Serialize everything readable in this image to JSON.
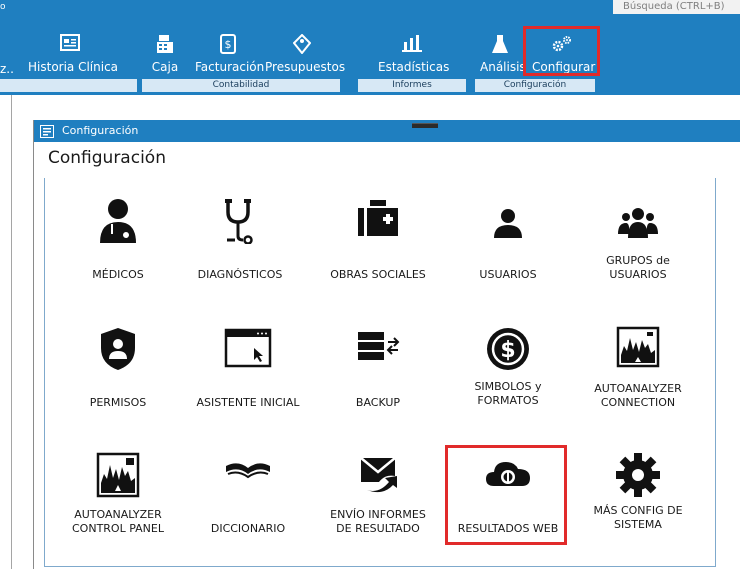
{
  "search": {
    "placeholder": "Búsqueda (CTRL+B)"
  },
  "ribbon": {
    "dot": "o",
    "truncated": "z..",
    "historia": "Historia Clínica",
    "caja": "Caja",
    "facturacion": "Facturación",
    "presupuestos": "Presupuestos",
    "estadisticas": "Estadísticas",
    "analisis": "Análisis",
    "configurar": "Configurar",
    "groups": {
      "contabilidad": "Contabilidad",
      "informes": "Informes",
      "configuracion": "Configuración"
    }
  },
  "window": {
    "title": "Configuración",
    "heading": "Configuración"
  },
  "tiles": {
    "medicos": "MÉDICOS",
    "diagnosticos": "DIAGNÓSTICOS",
    "obras": "OBRAS SOCIALES",
    "usuarios": "USUARIOS",
    "grupos1": "GRUPOS de",
    "grupos2": "USUARIOS",
    "permisos": "PERMISOS",
    "asistente": "ASISTENTE INICIAL",
    "backup": "BACKUP",
    "simbolos1": "SIMBOLOS y",
    "simbolos2": "FORMATOS",
    "autoconn1": "AUTOANALYZER",
    "autoconn2": "CONNECTION",
    "autopanel1": "AUTOANALYZER",
    "autopanel2": "CONTROL PANEL",
    "diccionario": "DICCIONARIO",
    "envio1": "ENVÍO INFORMES",
    "envio2": "DE RESULTADO",
    "resultados": "RESULTADOS WEB",
    "mas1": "MÁS CONFIG DE",
    "mas2": "SISTEMA"
  },
  "colors": {
    "accent": "#1f7fc0",
    "highlight": "#e12a2a",
    "icon": "#111111"
  }
}
